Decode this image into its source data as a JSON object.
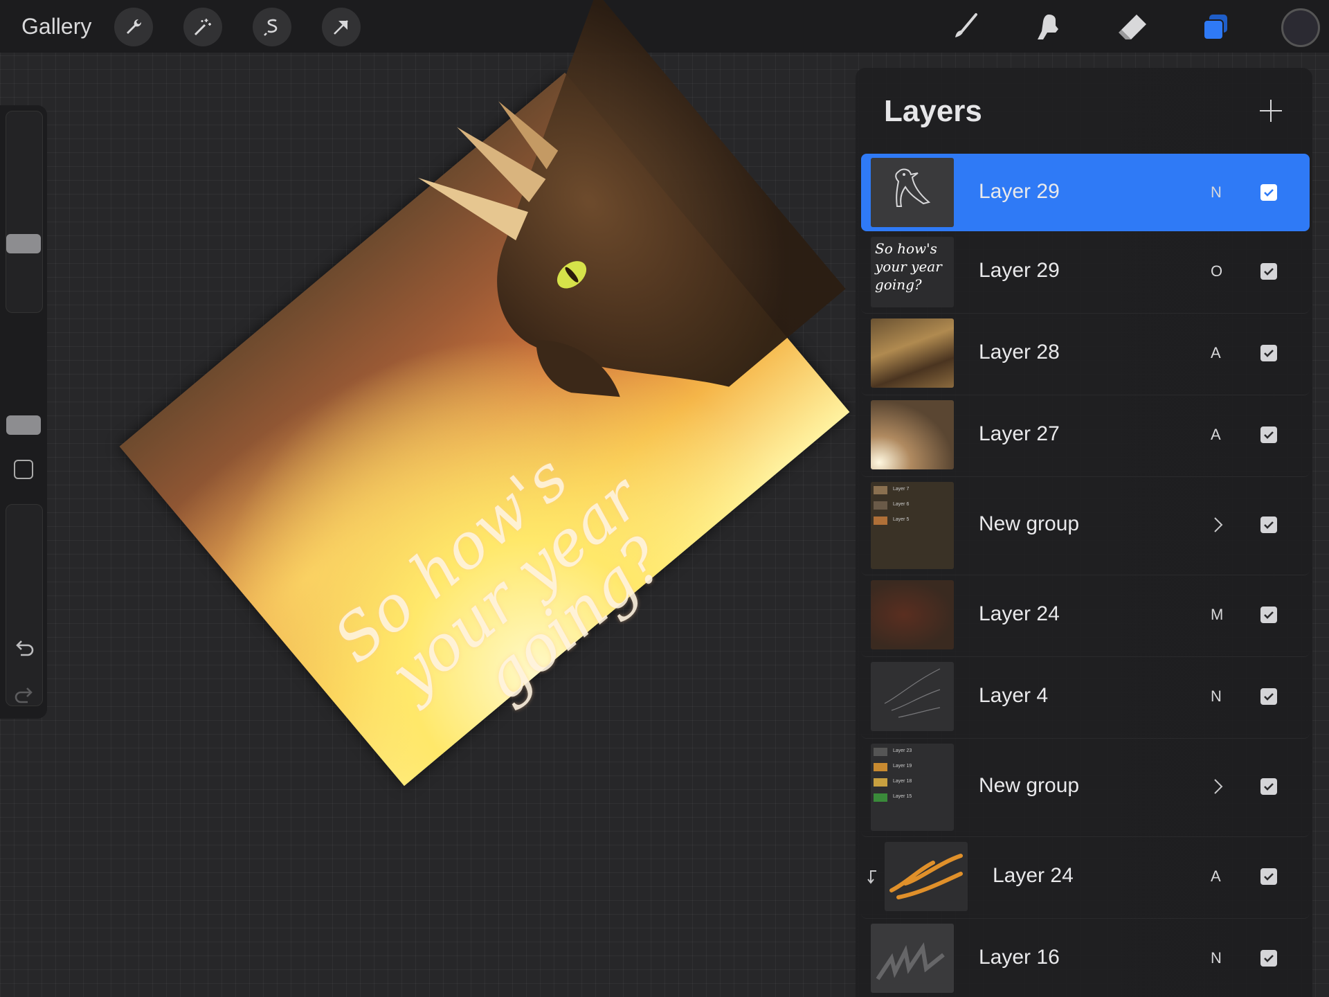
{
  "topbar": {
    "gallery_label": "Gallery",
    "left_tools": [
      "wrench-icon",
      "magic-wand-icon",
      "selection-icon",
      "transform-arrow-icon"
    ],
    "right_tools": [
      "brush-icon",
      "smudge-icon",
      "eraser-icon",
      "layers-icon"
    ],
    "accent_color": "#2f7af6"
  },
  "sidebar": {
    "brush_size_level": 0.62,
    "opacity_level": 0.56,
    "undo_icon": "undo-icon",
    "redo_icon": "redo-icon"
  },
  "artwork": {
    "lines": [
      "So how's",
      "your year",
      "going?"
    ]
  },
  "layers": {
    "title": "Layers",
    "items": [
      {
        "name": "Layer 29",
        "blend": "N",
        "visible": true,
        "selected": true,
        "type": "layer"
      },
      {
        "name": "Layer 29",
        "blend": "O",
        "visible": true,
        "type": "layer",
        "thumb_text": [
          "So how's",
          "your year",
          "going?"
        ]
      },
      {
        "name": "Layer 28",
        "blend": "A",
        "visible": true,
        "type": "layer"
      },
      {
        "name": "Layer 27",
        "blend": "A",
        "visible": true,
        "type": "layer"
      },
      {
        "name": "New group",
        "visible": true,
        "type": "group",
        "thumb_rows": [
          "Layer 7",
          "Layer 6",
          "Layer 5"
        ]
      },
      {
        "name": "Layer 24",
        "blend": "M",
        "visible": true,
        "type": "layer"
      },
      {
        "name": "Layer 4",
        "blend": "N",
        "visible": true,
        "type": "layer"
      },
      {
        "name": "New group",
        "visible": true,
        "type": "group",
        "thumb_rows": [
          "Layer 23",
          "Layer 19",
          "Layer 18",
          "Layer 15"
        ]
      },
      {
        "name": "Layer 24",
        "blend": "A",
        "visible": true,
        "type": "layer",
        "clipped": true
      },
      {
        "name": "Layer 16",
        "blend": "N",
        "visible": true,
        "type": "layer"
      }
    ]
  }
}
